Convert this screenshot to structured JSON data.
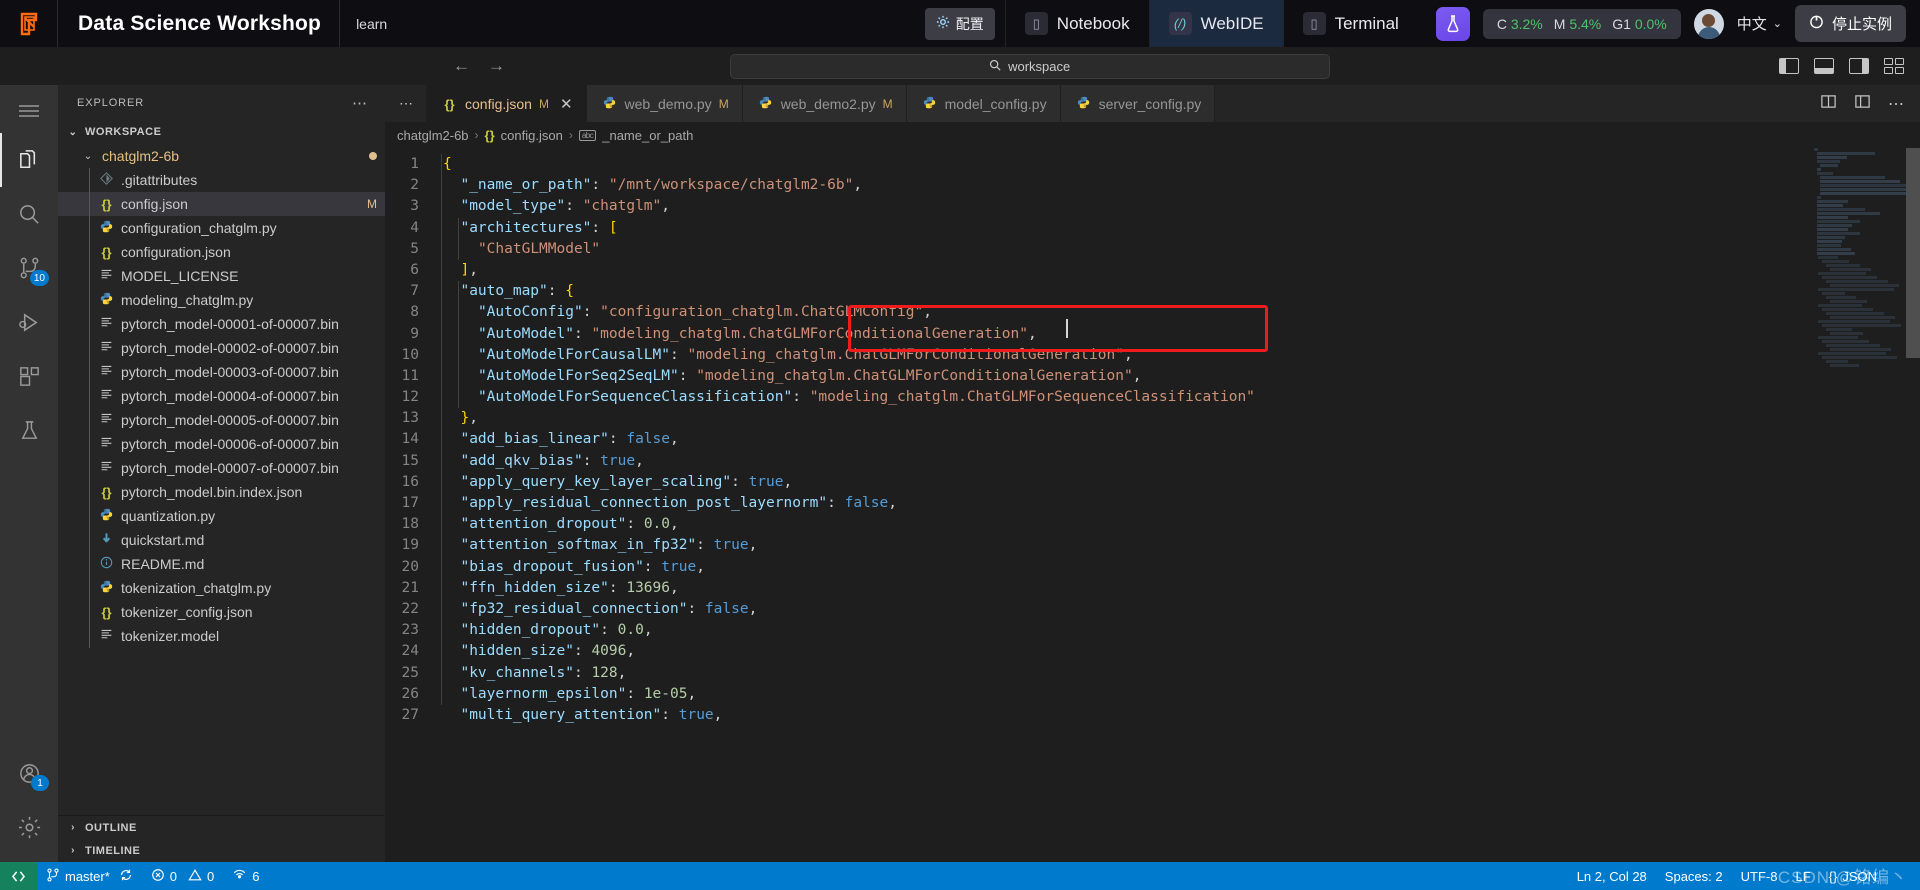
{
  "brand": {
    "logo_icon": "platform-logo-icon",
    "title": "Data Science Workshop",
    "subtitle": "learn",
    "config_label": "配置",
    "config_icon": "gear-icon",
    "nav": [
      {
        "label": "Notebook",
        "icon": "notebook-icon",
        "active": false
      },
      {
        "label": "WebIDE",
        "icon": "webide-icon",
        "active": true
      },
      {
        "label": "Terminal",
        "icon": "terminal-icon",
        "active": false
      }
    ],
    "flask_icon": "flask-icon",
    "metrics": [
      {
        "label": "C",
        "value": "3.2%"
      },
      {
        "label": "M",
        "value": "5.4%"
      },
      {
        "label": "G1",
        "value": "0.0%"
      }
    ],
    "metric_color": "#4ec26b",
    "avatar_icon": "user-avatar",
    "language": "中文",
    "language_chevron": "chevron-down-icon",
    "stop_label": "停止实例",
    "stop_icon": "power-icon"
  },
  "cmdbar": {
    "back_icon": "arrow-left-icon",
    "forward_icon": "arrow-right-icon",
    "search_placeholder": "workspace",
    "search_icon": "search-icon",
    "layout_icons": [
      "toggle-primary-sidebar-icon",
      "toggle-panel-icon",
      "toggle-secondary-sidebar-icon",
      "customize-layout-icon"
    ]
  },
  "activitybar": {
    "menu_icon": "hamburger-menu-icon",
    "items": [
      {
        "name": "explorer",
        "icon": "files-icon",
        "active": true,
        "badge": ""
      },
      {
        "name": "search",
        "icon": "search-icon",
        "active": false,
        "badge": ""
      },
      {
        "name": "source-control",
        "icon": "source-control-icon",
        "active": false,
        "badge": "10"
      },
      {
        "name": "run-and-debug",
        "icon": "run-debug-icon",
        "active": false,
        "badge": ""
      },
      {
        "name": "extensions",
        "icon": "extensions-icon",
        "active": false,
        "badge": ""
      },
      {
        "name": "testing",
        "icon": "beaker-icon",
        "active": false,
        "badge": ""
      }
    ],
    "bottom": [
      {
        "name": "accounts",
        "icon": "account-icon",
        "badge": "1"
      },
      {
        "name": "settings",
        "icon": "gear-icon",
        "badge": ""
      }
    ]
  },
  "sidebar": {
    "title": "EXPLORER",
    "more_icon": "ellipsis-icon",
    "workspace_label": "WORKSPACE",
    "root_folder": "chatglm2-6b",
    "files": [
      {
        "name": ".gitattributes",
        "icon": "git-file-icon",
        "kind": "git",
        "badge": ""
      },
      {
        "name": "config.json",
        "icon": "json-file-icon",
        "kind": "json",
        "badge": "M",
        "selected": true
      },
      {
        "name": "configuration_chatglm.py",
        "icon": "python-file-icon",
        "kind": "py",
        "badge": ""
      },
      {
        "name": "configuration.json",
        "icon": "json-file-icon",
        "kind": "json",
        "badge": ""
      },
      {
        "name": "MODEL_LICENSE",
        "icon": "text-file-icon",
        "kind": "txt",
        "badge": ""
      },
      {
        "name": "modeling_chatglm.py",
        "icon": "python-file-icon",
        "kind": "py",
        "badge": ""
      },
      {
        "name": "pytorch_model-00001-of-00007.bin",
        "icon": "text-file-icon",
        "kind": "txt",
        "badge": ""
      },
      {
        "name": "pytorch_model-00002-of-00007.bin",
        "icon": "text-file-icon",
        "kind": "txt",
        "badge": ""
      },
      {
        "name": "pytorch_model-00003-of-00007.bin",
        "icon": "text-file-icon",
        "kind": "txt",
        "badge": ""
      },
      {
        "name": "pytorch_model-00004-of-00007.bin",
        "icon": "text-file-icon",
        "kind": "txt",
        "badge": ""
      },
      {
        "name": "pytorch_model-00005-of-00007.bin",
        "icon": "text-file-icon",
        "kind": "txt",
        "badge": ""
      },
      {
        "name": "pytorch_model-00006-of-00007.bin",
        "icon": "text-file-icon",
        "kind": "txt",
        "badge": ""
      },
      {
        "name": "pytorch_model-00007-of-00007.bin",
        "icon": "text-file-icon",
        "kind": "txt",
        "badge": ""
      },
      {
        "name": "pytorch_model.bin.index.json",
        "icon": "json-file-icon",
        "kind": "json",
        "badge": ""
      },
      {
        "name": "quantization.py",
        "icon": "python-file-icon",
        "kind": "py",
        "badge": ""
      },
      {
        "name": "quickstart.md",
        "icon": "markdown-file-icon",
        "kind": "md",
        "badge": ""
      },
      {
        "name": "README.md",
        "icon": "info-file-icon",
        "kind": "info",
        "badge": ""
      },
      {
        "name": "tokenization_chatglm.py",
        "icon": "python-file-icon",
        "kind": "py",
        "badge": ""
      },
      {
        "name": "tokenizer_config.json",
        "icon": "json-file-icon",
        "kind": "json",
        "badge": ""
      },
      {
        "name": "tokenizer.model",
        "icon": "text-file-icon",
        "kind": "txt",
        "badge": ""
      }
    ],
    "outline_label": "OUTLINE",
    "timeline_label": "TIMELINE"
  },
  "editor": {
    "overflow_icon": "ellipsis-icon",
    "tabs": [
      {
        "label": "config.json",
        "icon": "json-file-icon",
        "kind": "json",
        "modified": "M",
        "active": true,
        "close_icon": "close-icon"
      },
      {
        "label": "web_demo.py",
        "icon": "python-file-icon",
        "kind": "py",
        "modified": "M",
        "active": false
      },
      {
        "label": "web_demo2.py",
        "icon": "python-file-icon",
        "kind": "py",
        "modified": "M",
        "active": false
      },
      {
        "label": "model_config.py",
        "icon": "python-file-icon",
        "kind": "py",
        "modified": "",
        "active": false
      },
      {
        "label": "server_config.py",
        "icon": "python-file-icon",
        "kind": "py",
        "modified": "",
        "active": false
      }
    ],
    "tabbar_actions": [
      "split-editor-icon",
      "open-changes-icon",
      "more-actions-icon"
    ],
    "breadcrumb": [
      {
        "label": "chatglm2-6b",
        "icon": ""
      },
      {
        "label": "config.json",
        "icon": "json-file-icon"
      },
      {
        "label": "_name_or_path",
        "icon": "abc-symbol-icon"
      }
    ],
    "lines": [
      {
        "n": 1,
        "text": "{"
      },
      {
        "n": 2,
        "text": "  \"_name_or_path\": \"/mnt/workspace/chatglm2-6b\","
      },
      {
        "n": 3,
        "text": "  \"model_type\": \"chatglm\","
      },
      {
        "n": 4,
        "text": "  \"architectures\": ["
      },
      {
        "n": 5,
        "text": "    \"ChatGLMModel\""
      },
      {
        "n": 6,
        "text": "  ],"
      },
      {
        "n": 7,
        "text": "  \"auto_map\": {"
      },
      {
        "n": 8,
        "text": "    \"AutoConfig\": \"configuration_chatglm.ChatGLMConfig\","
      },
      {
        "n": 9,
        "text": "    \"AutoModel\": \"modeling_chatglm.ChatGLMForConditionalGeneration\","
      },
      {
        "n": 10,
        "text": "    \"AutoModelForCausalLM\": \"modeling_chatglm.ChatGLMForConditionalGeneration\","
      },
      {
        "n": 11,
        "text": "    \"AutoModelForSeq2SeqLM\": \"modeling_chatglm.ChatGLMForConditionalGeneration\","
      },
      {
        "n": 12,
        "text": "    \"AutoModelForSequenceClassification\": \"modeling_chatglm.ChatGLMForSequenceClassification\""
      },
      {
        "n": 13,
        "text": "  },"
      },
      {
        "n": 14,
        "text": "  \"add_bias_linear\": false,"
      },
      {
        "n": 15,
        "text": "  \"add_qkv_bias\": true,"
      },
      {
        "n": 16,
        "text": "  \"apply_query_key_layer_scaling\": true,"
      },
      {
        "n": 17,
        "text": "  \"apply_residual_connection_post_layernorm\": false,"
      },
      {
        "n": 18,
        "text": "  \"attention_dropout\": 0.0,"
      },
      {
        "n": 19,
        "text": "  \"attention_softmax_in_fp32\": true,"
      },
      {
        "n": 20,
        "text": "  \"bias_dropout_fusion\": true,"
      },
      {
        "n": 21,
        "text": "  \"ffn_hidden_size\": 13696,"
      },
      {
        "n": 22,
        "text": "  \"fp32_residual_connection\": false,"
      },
      {
        "n": 23,
        "text": "  \"hidden_dropout\": 0.0,"
      },
      {
        "n": 24,
        "text": "  \"hidden_size\": 4096,"
      },
      {
        "n": 25,
        "text": "  \"kv_channels\": 128,"
      },
      {
        "n": 26,
        "text": "  \"layernorm_epsilon\": 1e-05,"
      },
      {
        "n": 27,
        "text": "  \"multi_query_attention\": true,"
      }
    ],
    "highlight_color": "#f01c1c"
  },
  "statusbar": {
    "remote_icon": "remote-window-icon",
    "branch": "master*",
    "branch_icon": "source-control-icon",
    "sync_icon": "sync-icon",
    "errors": "0",
    "errors_icon": "error-icon",
    "warnings": "0",
    "warnings_icon": "warning-icon",
    "ports": "6",
    "ports_icon": "ports-icon",
    "position": "Ln 2, Col 28",
    "spaces": "Spaces: 2",
    "encoding": "UTF-8",
    "eol": "LF",
    "language": "JSON",
    "language_icon": "json-file-icon",
    "watermark": "CSDN @铭编丶"
  }
}
